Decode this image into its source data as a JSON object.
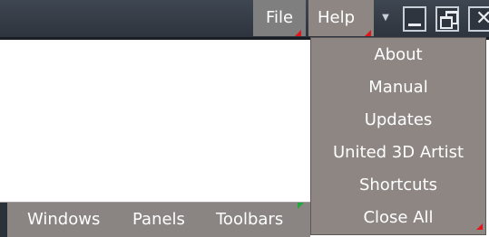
{
  "menubar": {
    "file_label": "File",
    "help_label": "Help",
    "dropdown_arrow": "▼",
    "close_glyph": "✕"
  },
  "help_menu": {
    "items": [
      "About",
      "Manual",
      "Updates",
      "United 3D Artist",
      "Shortcuts",
      "Close All"
    ]
  },
  "bottom_toolbar": {
    "items": [
      "Windows",
      "Panels",
      "Toolbars"
    ]
  },
  "colors": {
    "titlebar": "#353c46",
    "menu_bg": "#8e8683",
    "flag_red": "#e0161a",
    "flag_green": "#1faa3b",
    "text": "#ffffff"
  },
  "icons": [
    "minimize-icon",
    "restore-icon",
    "close-icon",
    "dropdown-arrow-icon"
  ]
}
